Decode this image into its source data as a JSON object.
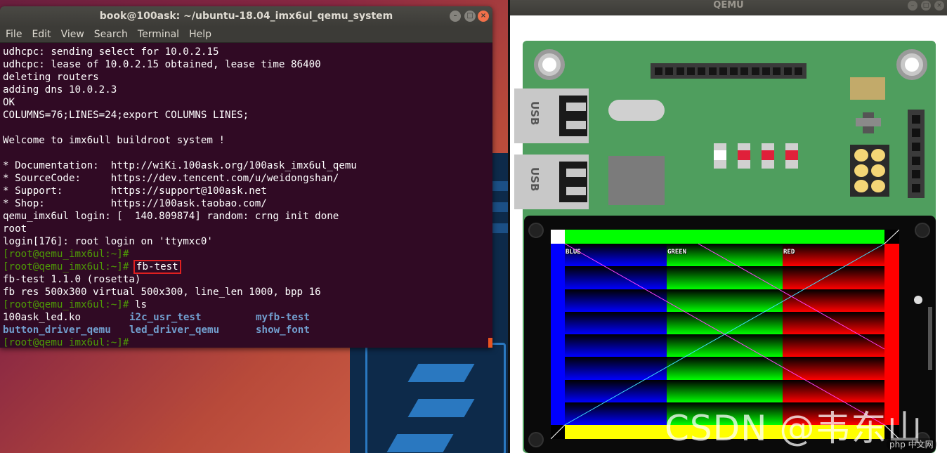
{
  "terminal": {
    "title": "book@100ask: ~/ubuntu-18.04_imx6ul_qemu_system",
    "menu": [
      "File",
      "Edit",
      "View",
      "Search",
      "Terminal",
      "Help"
    ],
    "lines": [
      "udhcpc: sending select for 10.0.2.15",
      "udhcpc: lease of 10.0.2.15 obtained, lease time 86400",
      "deleting routers",
      "adding dns 10.0.2.3",
      "OK",
      "COLUMNS=76;LINES=24;export COLUMNS LINES;",
      "",
      "Welcome to imx6ull buildroot system !",
      "",
      "* Documentation:  http://wiKi.100ask.org/100ask_imx6ul_qemu",
      "* SourceCode:     https://dev.tencent.com/u/weidongshan/",
      "* Support:        https://support@100ask.net",
      "* Shop:           https://100ask.taobao.com/",
      "qemu_imx6ul login: [  140.809874] random: crng init done",
      "root",
      "login[176]: root login on 'ttymxc0'"
    ],
    "prompt": "[root@qemu_imx6ul:~]#",
    "command_fbtest": "fb-test",
    "fbtest_output": [
      "fb-test 1.1.0 (rosetta)",
      "fb res 500x300 virtual 500x300, line_len 1000, bpp 16"
    ],
    "command_ls": "ls",
    "ls_items": [
      [
        "100ask_led.ko",
        "i2c_usr_test",
        "myfb-test"
      ],
      [
        "button_driver_qemu",
        "led_driver_qemu",
        "show_font"
      ]
    ]
  },
  "qemu": {
    "title": "QEMU",
    "usb_label": "USB",
    "fb_labels": {
      "blue": "BLUE",
      "green": "GREEN",
      "red": "RED"
    }
  },
  "watermark": "CSDN @韦东山",
  "badge": "php 中文网",
  "colors": {
    "terminal_bg": "#300a24",
    "prompt_green": "#4e9a06",
    "ls_blue": "#729fcf",
    "highlight_red": "#e02020",
    "board_green": "#4f9e5e"
  }
}
